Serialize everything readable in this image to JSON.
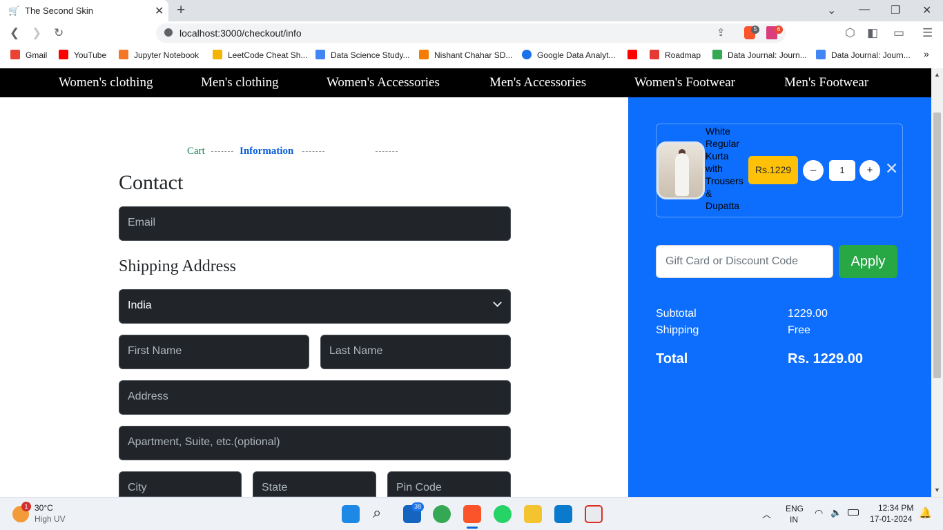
{
  "browser": {
    "tab_title": "The Second Skin",
    "url": "localhost:3000/checkout/info",
    "brave_shield_count": "5",
    "brave_rewards_count": "6",
    "bookmarks": [
      {
        "label": "Gmail",
        "color": "#ea4335"
      },
      {
        "label": "YouTube",
        "color": "#ff0000"
      },
      {
        "label": "Jupyter Notebook",
        "color": "#f37726"
      },
      {
        "label": "LeetCode Cheat Sh...",
        "color": "#f5b400"
      },
      {
        "label": "Data Science Study...",
        "color": "#4285f4"
      },
      {
        "label": "Nishant Chahar SD...",
        "color": "#f57c00"
      },
      {
        "label": "Google Data Analyt...",
        "color": "#1a73e8"
      },
      {
        "label": "",
        "color": "#ff0000"
      },
      {
        "label": "Roadmap",
        "color": "#e53935"
      },
      {
        "label": "Data Journal: Journ...",
        "color": "#34a853"
      },
      {
        "label": "Data Journal: Journ...",
        "color": "#4285f4"
      }
    ]
  },
  "site_nav": [
    "Women's clothing",
    "Men's clothing",
    "Women's Accessories",
    "Men's Accessories",
    "Women's Footwear",
    "Men's Footwear"
  ],
  "steps": {
    "cart": "Cart",
    "information": "Information"
  },
  "contact": {
    "title": "Contact",
    "email_placeholder": "Email"
  },
  "shipping": {
    "title": "Shipping Address",
    "country": "India",
    "first_name_placeholder": "First Name",
    "last_name_placeholder": "Last Name",
    "address_placeholder": "Address",
    "apartment_placeholder": "Apartment, Suite, etc.(optional)",
    "city_placeholder": "City",
    "state_placeholder": "State",
    "pin_placeholder": "Pin Code"
  },
  "cart": {
    "item_name": "White Regular Kurta with Trousers & Dupatta",
    "price": "Rs.1229",
    "quantity": "1",
    "minus": "–",
    "plus": "+",
    "remove": "✕"
  },
  "discount": {
    "placeholder": "Gift Card or Discount Code",
    "apply_label": "Apply"
  },
  "summary": {
    "subtotal_label": "Subtotal",
    "subtotal_value": "1229.00",
    "shipping_label": "Shipping",
    "shipping_value": "Free",
    "total_label": "Total",
    "total_value": "Rs. 1229.00"
  },
  "taskbar": {
    "weather_temp": "30°C",
    "weather_desc": "High UV",
    "weather_badge": "1",
    "mail_badge": "38",
    "lang": "ENG",
    "region": "IN",
    "time": "12:34 PM",
    "date": "17-01-2024"
  }
}
